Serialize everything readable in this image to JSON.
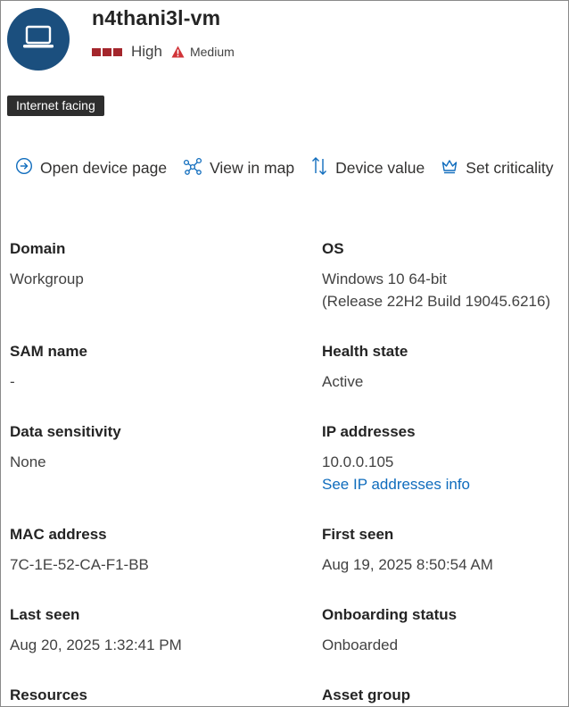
{
  "device": {
    "name": "n4thani3l-vm",
    "risk_level": "High",
    "exposure_level": "Medium",
    "tag": "Internet facing",
    "colors": {
      "avatar": "#1b4f7e",
      "risk": "#a4262c",
      "warning": "#d13438",
      "link": "#0f6cbd"
    }
  },
  "actions": [
    {
      "label": "Open device page",
      "icon": "arrow-circle-right-icon"
    },
    {
      "label": "View in map",
      "icon": "graph-map-icon"
    },
    {
      "label": "Device value",
      "icon": "arrow-sort-icon"
    },
    {
      "label": "Set criticality",
      "icon": "crown-icon"
    }
  ],
  "fields": {
    "domain": {
      "label": "Domain",
      "value": "Workgroup"
    },
    "os": {
      "label": "OS",
      "value": "Windows 10 64-bit",
      "value2": "(Release 22H2 Build 19045.6216)"
    },
    "sam_name": {
      "label": "SAM name",
      "value": "-"
    },
    "health_state": {
      "label": "Health state",
      "value": "Active"
    },
    "data_sensitivity": {
      "label": "Data sensitivity",
      "value": "None"
    },
    "ip_addresses": {
      "label": "IP addresses",
      "value": "10.0.0.105",
      "link": "See IP addresses info"
    },
    "mac_address": {
      "label": "MAC address",
      "value": "7C-1E-52-CA-F1-BB"
    },
    "first_seen": {
      "label": "First seen",
      "value": "Aug 19, 2025 8:50:54 AM"
    },
    "last_seen": {
      "label": "Last seen",
      "value": "Aug 20, 2025 1:32:41 PM"
    },
    "onboarding_status": {
      "label": "Onboarding status",
      "value": "Onboarded"
    },
    "resources": {
      "label": "Resources"
    },
    "asset_group": {
      "label": "Asset group"
    }
  }
}
